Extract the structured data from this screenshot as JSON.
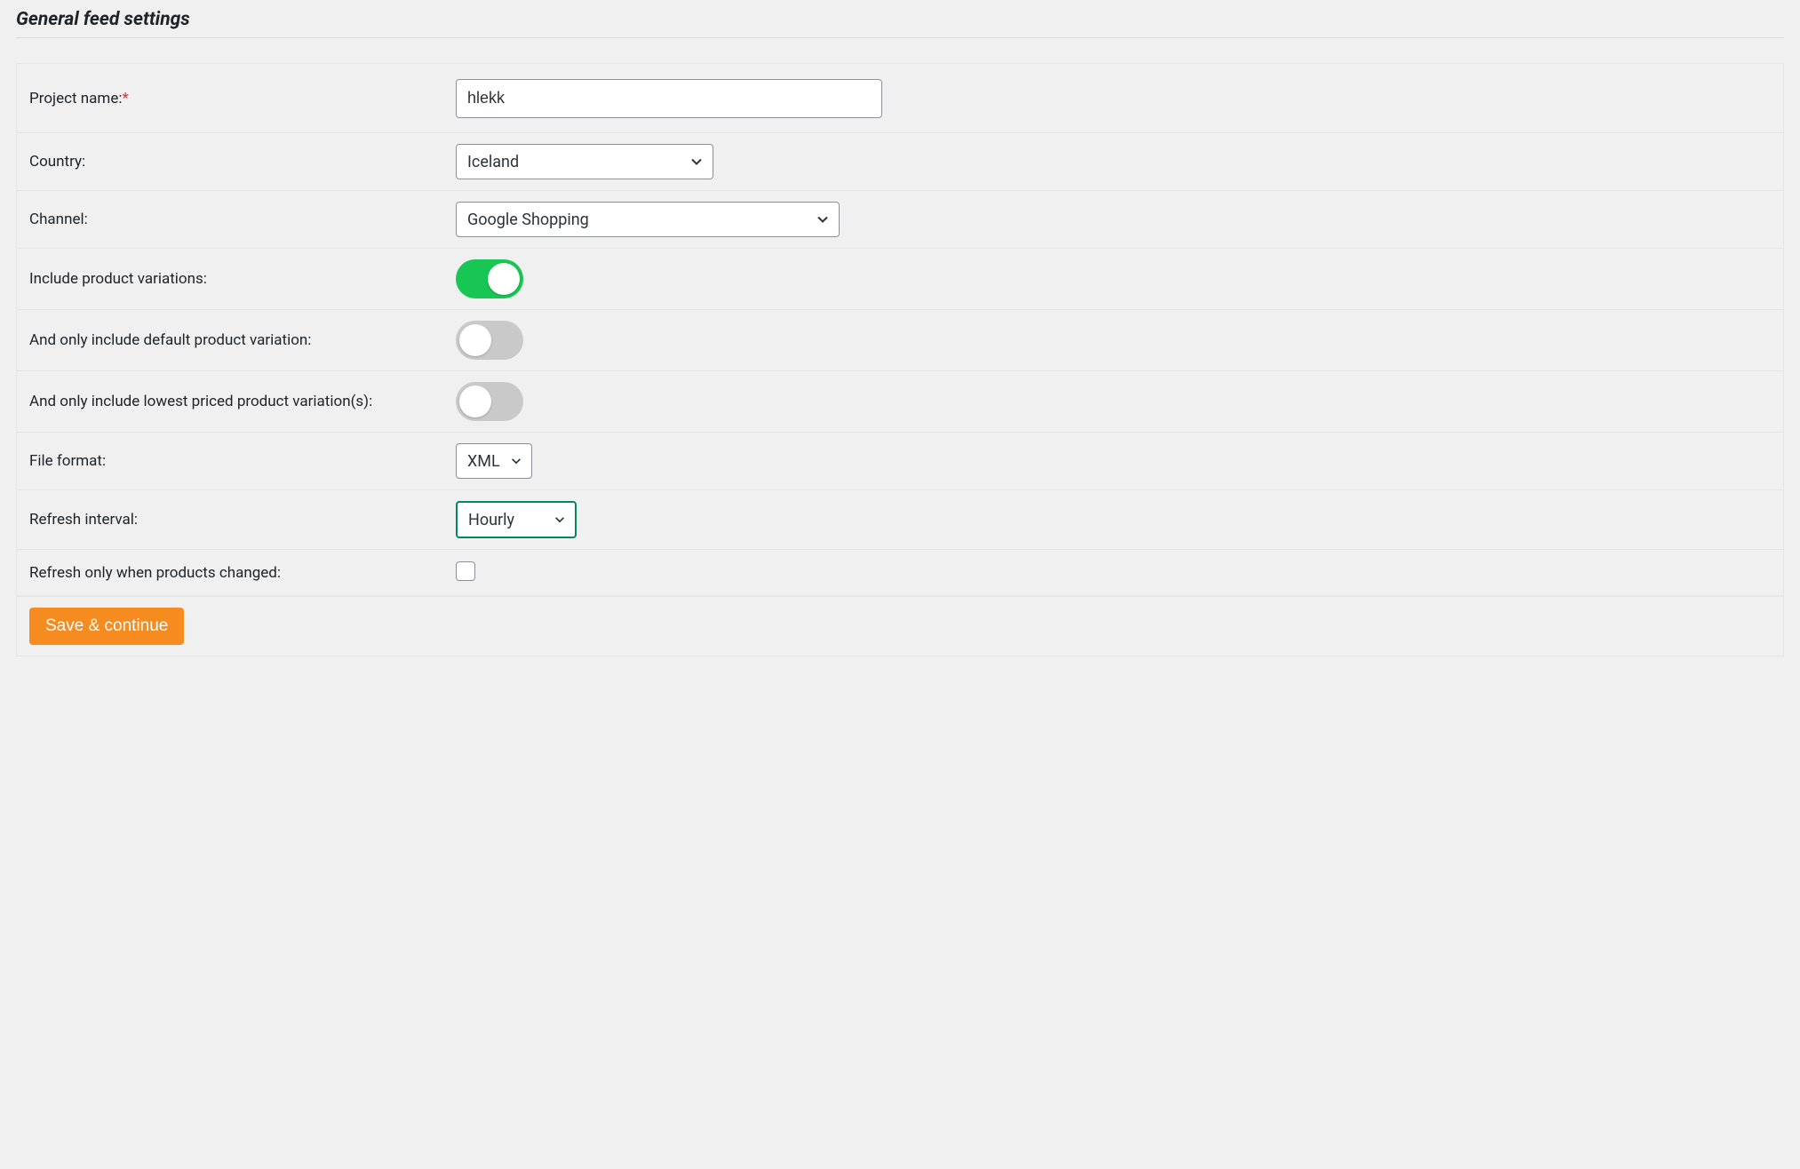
{
  "section_title": "General feed settings",
  "rows": {
    "project_name": {
      "label": "Project name:",
      "required": "*",
      "value": "hlekk"
    },
    "country": {
      "label": "Country:",
      "value": "Iceland"
    },
    "channel": {
      "label": "Channel:",
      "value": "Google Shopping"
    },
    "include_variations": {
      "label": "Include product variations:"
    },
    "only_default_variation": {
      "label": "And only include default product variation:"
    },
    "only_lowest_priced": {
      "label": "And only include lowest priced product variation(s):"
    },
    "file_format": {
      "label": "File format:",
      "value": "XML"
    },
    "refresh_interval": {
      "label": "Refresh interval:",
      "value": "Hourly"
    },
    "refresh_only_changed": {
      "label": "Refresh only when products changed:"
    }
  },
  "buttons": {
    "save": "Save & continue"
  }
}
